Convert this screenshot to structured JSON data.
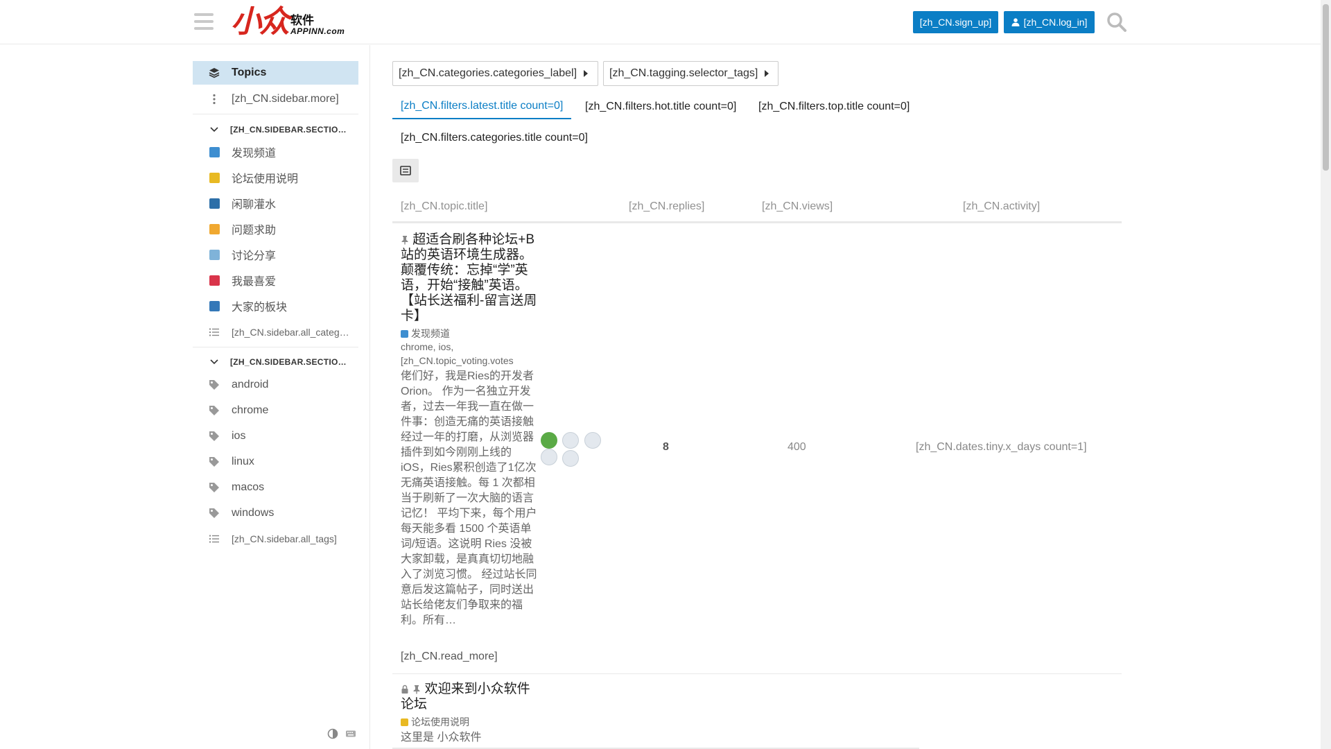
{
  "header": {
    "signup_label": "[zh_CN.sign_up]",
    "login_label": "[zh_CN.log_in]",
    "logo_mark": "小众",
    "logo_cn": "软件",
    "logo_en": "APPINN.com"
  },
  "sidebar": {
    "topics": "Topics",
    "more": "[zh_CN.sidebar.more]",
    "section_categories": "[ZH_CN.SIDEBAR.SECTIONS.CATEGORIES.HEADER_TEXT]",
    "categories": [
      {
        "label": "发现频道",
        "color": "#3e8ed0"
      },
      {
        "label": "论坛使用说明",
        "color": "#e8b923"
      },
      {
        "label": "闲聊灌水",
        "color": "#2d6fa8"
      },
      {
        "label": "问题求助",
        "color": "#f0a830"
      },
      {
        "label": "讨论分享",
        "color": "#7fb3d9"
      },
      {
        "label": "我最喜爱",
        "color": "#d9344a"
      },
      {
        "label": "大家的板块",
        "color": "#3478b8"
      }
    ],
    "all_categories": "[zh_CN.sidebar.all_categories]",
    "section_tags": "[ZH_CN.SIDEBAR.SECTIONS.TAGS.HEADER_TEXT]",
    "tags": [
      "android",
      "chrome",
      "ios",
      "linux",
      "macos",
      "windows"
    ],
    "all_tags": "[zh_CN.sidebar.all_tags]"
  },
  "filters": {
    "categories_label": "[zh_CN.categories.categories_label]",
    "tags_label": "[zh_CN.tagging.selector_tags]",
    "tabs": [
      "[zh_CN.filters.latest.title count=0]",
      "[zh_CN.filters.hot.title count=0]",
      "[zh_CN.filters.top.title count=0]",
      "[zh_CN.filters.categories.title count=0]"
    ]
  },
  "table": {
    "col_title": "[zh_CN.topic.title]",
    "col_replies": "[zh_CN.replies]",
    "col_views": "[zh_CN.views]",
    "col_activity": "[zh_CN.activity]"
  },
  "topics": [
    {
      "title": "超适合刷各种论坛+B站的英语环境生成器。颠覆传统：忘掉“学”英语，开始“接触”英语。【站长送福利-留言送周卡】",
      "category": "发现频道",
      "category_color": "#3e8ed0",
      "tags": "chrome, ios, [zh_CN.topic_voting.votes count=2]",
      "excerpt": "佬们好，我是Ries的开发者Orion。 作为一名独立开发者，过去一年我一直在做一件事：创造无痛的英语接触 经过一年的打磨，从浏览器插件到如今刚刚上线的iOS，Ries累积创造了1亿次无痛英语接触。每 1 次都相当于刷新了一次大脑的语言记忆！ 平均下来，每个用户每天能多看 1500 个英语单词/短语。这说明 Ries 没被大家卸载，是真真切切地融入了浏览习惯。 经过站长同意后发这篇帖子，同时送出站长给佬友们争取来的福利。所有…",
      "read_more": "[zh_CN.read_more]",
      "replies": "8",
      "views": "400",
      "activity": "[zh_CN.dates.tiny.x_days count=1]"
    },
    {
      "title": "欢迎来到小众软件论坛",
      "category": "论坛使用说明",
      "category_color": "#e8b923",
      "excerpt": "这里是 小众软件"
    }
  ]
}
